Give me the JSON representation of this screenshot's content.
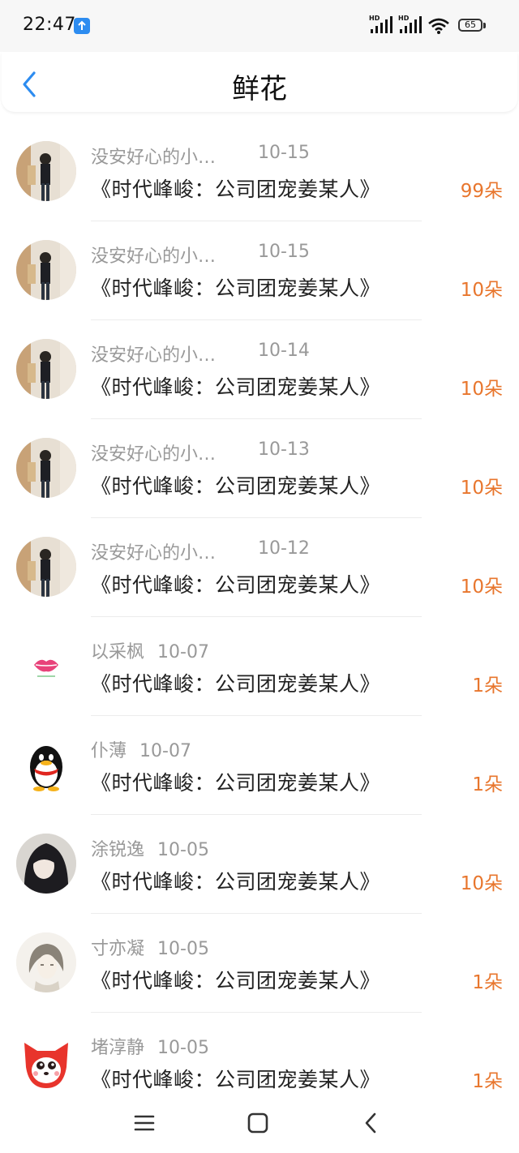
{
  "status_bar": {
    "time": "22:47",
    "battery": "65"
  },
  "header": {
    "title": "鲜花"
  },
  "records": [
    {
      "name": "没安好心的小…",
      "date": "10-15",
      "book": "《时代峰峻：公司团宠姜某人》",
      "count": "99朵",
      "avatar": "photo-girl-avatar"
    },
    {
      "name": "没安好心的小…",
      "date": "10-15",
      "book": "《时代峰峻：公司团宠姜某人》",
      "count": "10朵",
      "avatar": "photo-girl-avatar"
    },
    {
      "name": "没安好心的小…",
      "date": "10-14",
      "book": "《时代峰峻：公司团宠姜某人》",
      "count": "10朵",
      "avatar": "photo-girl-avatar"
    },
    {
      "name": "没安好心的小…",
      "date": "10-13",
      "book": "《时代峰峻：公司团宠姜某人》",
      "count": "10朵",
      "avatar": "photo-girl-avatar"
    },
    {
      "name": "没安好心的小…",
      "date": "10-12",
      "book": "《时代峰峻：公司团宠姜某人》",
      "count": "10朵",
      "avatar": "photo-girl-avatar"
    },
    {
      "name": "以采枫",
      "date": "10-07",
      "book": "《时代峰峻：公司团宠姜某人》",
      "count": "1朵",
      "avatar": "lips-avatar"
    },
    {
      "name": "仆薄",
      "date": "10-07",
      "book": "《时代峰峻：公司团宠姜某人》",
      "count": "1朵",
      "avatar": "penguin-avatar"
    },
    {
      "name": "涂锐逸",
      "date": "10-05",
      "book": "《时代峰峻：公司团宠姜某人》",
      "count": "10朵",
      "avatar": "anime-girl-avatar"
    },
    {
      "name": "寸亦凝",
      "date": "10-05",
      "book": "《时代峰峻：公司团宠姜某人》",
      "count": "1朵",
      "avatar": "sketch-girl-avatar"
    },
    {
      "name": "堵淳静",
      "date": "10-05",
      "book": "《时代峰峻：公司团宠姜某人》",
      "count": "1朵",
      "avatar": "red-fox-avatar"
    }
  ],
  "colors": {
    "accent_count": "#e8762d",
    "back_arrow": "#2d8cf0",
    "meta_text": "#999999"
  },
  "icons": {
    "back": "chevron-left-icon",
    "nav_menu": "menu-icon",
    "nav_home": "square-home-icon",
    "nav_back": "back-icon",
    "upload_badge": "upload-arrow-icon",
    "wifi": "wifi-icon",
    "signal": "signal-icon",
    "battery": "battery-icon"
  }
}
